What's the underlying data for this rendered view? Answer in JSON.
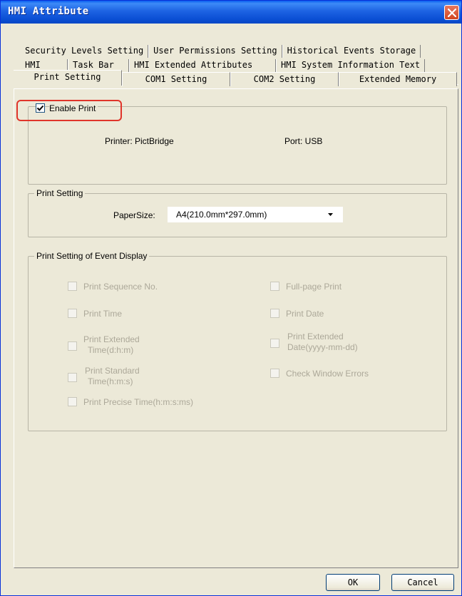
{
  "window": {
    "title": "HMI Attribute"
  },
  "tabs": {
    "row1": [
      "Security Levels Setting",
      "User Permissions Setting",
      "Historical Events Storage"
    ],
    "row2": [
      "HMI",
      "Task Bar",
      "HMI Extended Attributes",
      "HMI System Information Text"
    ],
    "row3": [
      "Print Setting",
      "COM1 Setting",
      "COM2 Setting",
      "Extended Memory"
    ],
    "active": "Print Setting"
  },
  "enable_print": {
    "label": "Enable Print",
    "checked": true,
    "printer_label": "Printer: PictBridge",
    "port_label": "Port: USB"
  },
  "print_setting": {
    "title": "Print Setting",
    "paper_size_label": "PaperSize:",
    "paper_size_value": "A4(210.0mm*297.0mm)"
  },
  "event_display": {
    "title": "Print Setting of Event Display",
    "options": {
      "seq": "Print Sequence No.",
      "fullpage": "Full-page Print",
      "time": "Print Time",
      "date": "Print Date",
      "ext_time_1": "Print Extended",
      "ext_time_2": "Time(d:h:m)",
      "ext_date_1": "Print Extended",
      "ext_date_2": "Date(yyyy-mm-dd)",
      "std_time_1": "Print Standard",
      "std_time_2": "Time(h:m:s)",
      "check_errors": "Check Window Errors",
      "precise_time": "Print Precise Time(h:m:s:ms)"
    }
  },
  "buttons": {
    "ok": "OK",
    "cancel": "Cancel"
  },
  "colors": {
    "title_bar": "#0b4fd4",
    "highlight": "#e0342a",
    "dialog_bg": "#ece9d8"
  }
}
